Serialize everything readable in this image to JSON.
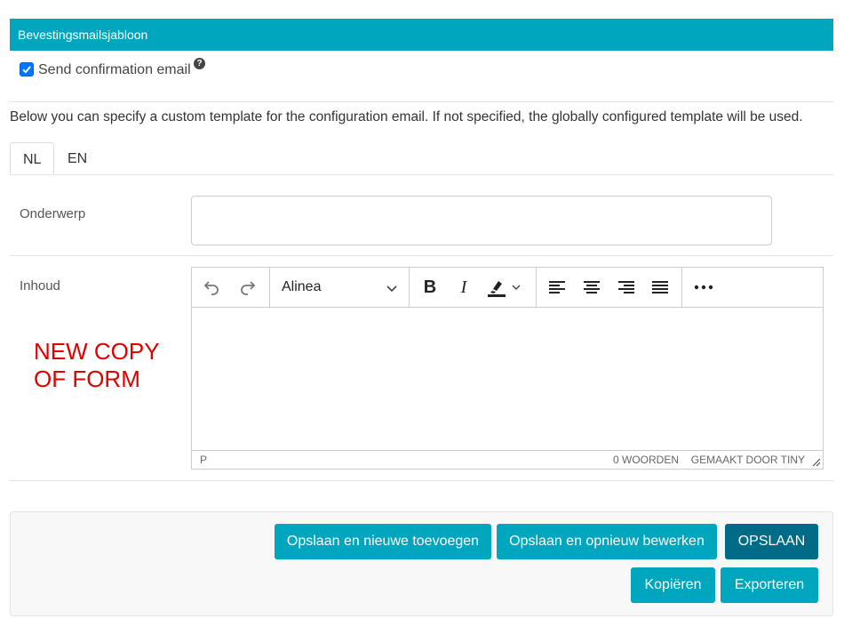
{
  "section": {
    "title": "Bevestingsmailsjabloon"
  },
  "confirmation": {
    "label": "Send confirmation email",
    "checked": true,
    "help_icon": "question-circle-icon"
  },
  "description": "Below you can specify a custom template for the configuration email. If not specified, the globally configured template will be used.",
  "tabs": [
    {
      "label": "NL",
      "active": true
    },
    {
      "label": "EN",
      "active": false
    }
  ],
  "subject": {
    "label": "Onderwerp",
    "value": ""
  },
  "content": {
    "label": "Inhoud",
    "toolbar": {
      "block_format": "Alinea",
      "icons": [
        "undo-icon",
        "redo-icon",
        "chevron-down-icon",
        "bold-icon",
        "italic-icon",
        "highlight-icon",
        "align-left-icon",
        "align-center-icon",
        "align-right-icon",
        "justify-icon",
        "more-icon"
      ]
    },
    "statusbar": {
      "path": "P",
      "word_count": "0 WOORDEN",
      "branding": "GEMAAKT DOOR TINY"
    }
  },
  "annotation": {
    "line1": "NEW COPY",
    "line2": "OF FORM"
  },
  "actions": {
    "save_add_new": "Opslaan en nieuwe toevoegen",
    "save_continue": "Opslaan en opnieuw bewerken",
    "save": "OPSLAAN",
    "copy": "Kopiëren",
    "export": "Exporteren"
  },
  "colors": {
    "accent": "#00a6bd",
    "primary_dark": "#006b87",
    "annotation": "#e00000"
  }
}
